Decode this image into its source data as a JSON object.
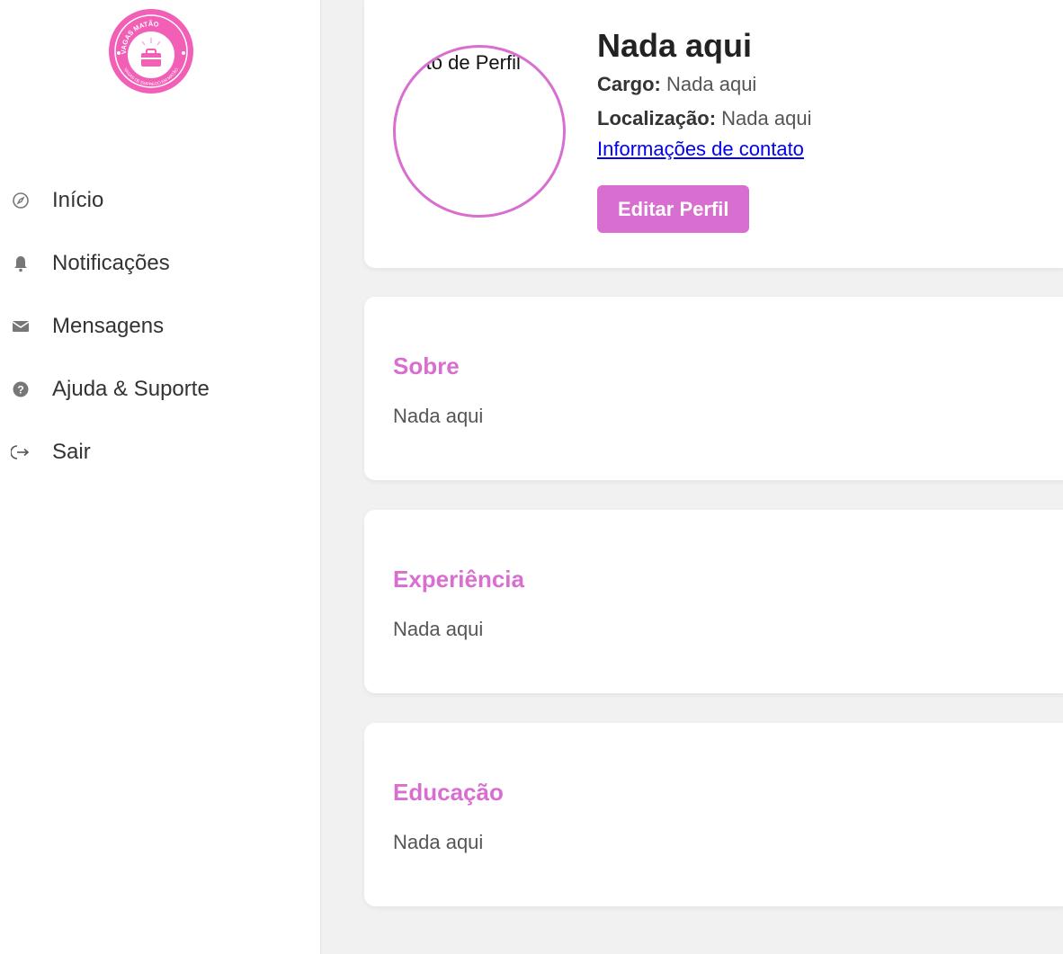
{
  "sidebar": {
    "logo": {
      "top_text": "VAGAS MATÃO",
      "bottom_text": "VAGAS DE EMPREGO EM MATÃO",
      "color": "#f25fb6"
    },
    "items": [
      {
        "label": "Início",
        "icon": "compass-icon"
      },
      {
        "label": "Notificações",
        "icon": "bell-icon"
      },
      {
        "label": "Mensagens",
        "icon": "envelope-icon"
      },
      {
        "label": "Ajuda & Suporte",
        "icon": "help-icon"
      },
      {
        "label": "Sair",
        "icon": "logout-icon"
      }
    ]
  },
  "profile": {
    "avatar_alt": "Foto de Perfil",
    "name": "Nada aqui",
    "cargo_label": "Cargo:",
    "cargo_value": "Nada aqui",
    "location_label": "Localização:",
    "location_value": "Nada aqui",
    "contact_link": "Informações de contato",
    "edit_button": "Editar Perfil"
  },
  "sections": [
    {
      "title": "Sobre",
      "text": "Nada aqui"
    },
    {
      "title": "Experiência",
      "text": "Nada aqui"
    },
    {
      "title": "Educação",
      "text": "Nada aqui"
    }
  ],
  "colors": {
    "accent": "#d86fd0",
    "background": "#f1f1f1",
    "link": "#0000ee"
  }
}
